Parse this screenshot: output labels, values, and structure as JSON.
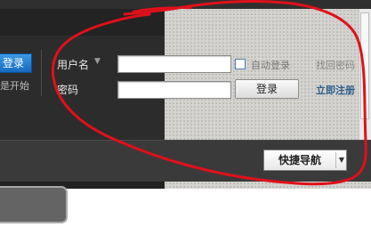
{
  "header": {
    "login_button_partial": "登录",
    "start_text_partial": "是开始"
  },
  "login_form": {
    "username_label": "用户名",
    "username_value": "",
    "password_label": "密码",
    "password_value": "",
    "auto_login_label": "自动登录",
    "auto_login_checked": false,
    "forgot_password_link": "找回密码",
    "submit_label": "登录",
    "register_link": "立即注册"
  },
  "nav": {
    "quick_nav_label": "快捷导航"
  },
  "colors": {
    "annotation_stroke": "#e0101a",
    "header_dark": "#2c2c2c",
    "login_blue": "#1f7ad6",
    "register_blue": "#2f5e8c"
  },
  "icons": {
    "username_dropdown": "caret-down-icon",
    "quick_nav_dropdown": "caret-down-icon"
  }
}
